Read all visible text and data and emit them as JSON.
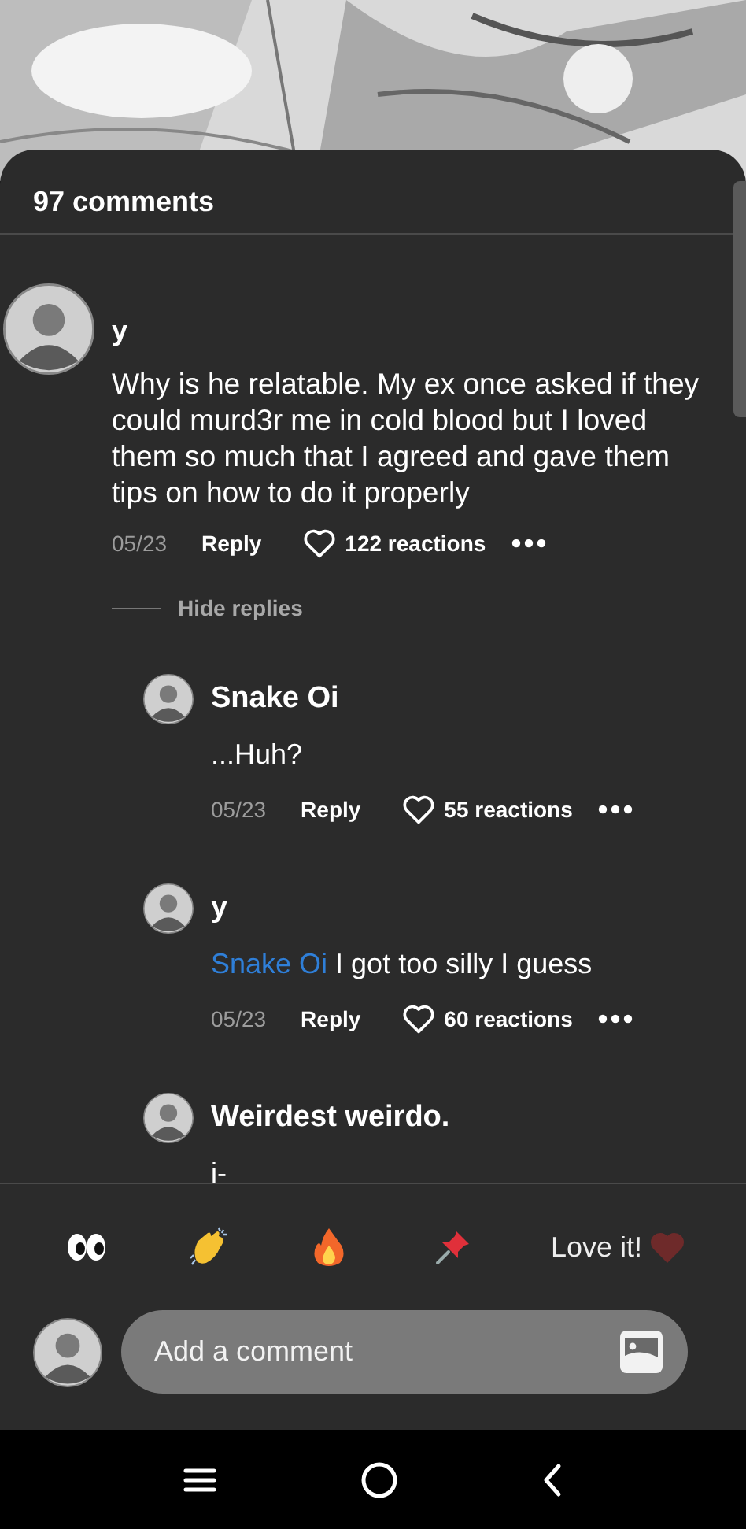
{
  "header": {
    "title": "97 comments"
  },
  "comments": [
    {
      "author": "y",
      "text": "Why is he relatable. My ex once asked if they could murd3r me in cold blood but I loved them so much that I agreed and gave them tips on how to do it properly",
      "date": "05/23",
      "reply_label": "Reply",
      "reactions": "122 reactions",
      "replies_toggle": "Hide replies",
      "replies": [
        {
          "author": "Snake Oi",
          "text": "...Huh?",
          "date": "05/23",
          "reply_label": "Reply",
          "reactions": "55 reactions"
        },
        {
          "author": "y",
          "mention": "Snake Oi",
          "text": "I got too silly I guess",
          "date": "05/23",
          "reply_label": "Reply",
          "reactions": "60 reactions"
        },
        {
          "author": "Weirdest weirdo.",
          "text": "i-"
        }
      ]
    }
  ],
  "reactions_bar": {
    "label": "Love it!"
  },
  "composer": {
    "placeholder": "Add a comment"
  }
}
